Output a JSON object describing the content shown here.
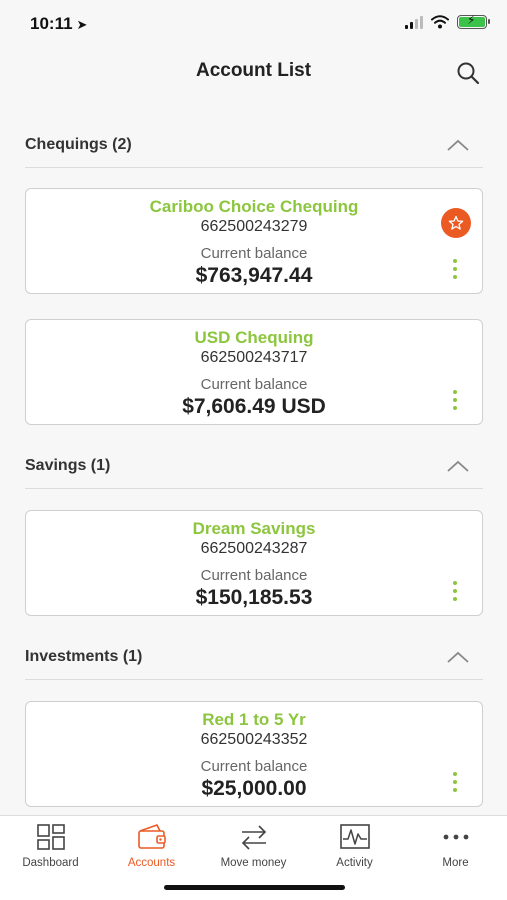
{
  "status": {
    "time": "10:11"
  },
  "header": {
    "title": "Account List"
  },
  "sections": [
    {
      "title": "Chequings (2)",
      "accounts": [
        {
          "name": "Cariboo Choice Chequing",
          "number": "662500243279",
          "balance_label": "Current balance",
          "balance": "$763,947.44",
          "favorite": true
        },
        {
          "name": "USD Chequing",
          "number": "662500243717",
          "balance_label": "Current balance",
          "balance": "$7,606.49 USD",
          "favorite": false
        }
      ]
    },
    {
      "title": "Savings (1)",
      "accounts": [
        {
          "name": "Dream Savings",
          "number": "662500243287",
          "balance_label": "Current balance",
          "balance": "$150,185.53",
          "favorite": false
        }
      ]
    },
    {
      "title": "Investments (1)",
      "accounts": [
        {
          "name": "Red 1 to 5 Yr",
          "number": "662500243352",
          "balance_label": "Current balance",
          "balance": "$25,000.00",
          "favorite": false
        }
      ]
    }
  ],
  "tabs": [
    {
      "label": "Dashboard",
      "icon": "dashboard-icon",
      "active": false
    },
    {
      "label": "Accounts",
      "icon": "wallet-icon",
      "active": true
    },
    {
      "label": "Move money",
      "icon": "transfer-arrows-icon",
      "active": false
    },
    {
      "label": "Activity",
      "icon": "activity-chart-icon",
      "active": false
    },
    {
      "label": "More",
      "icon": "more-dots-icon",
      "active": false
    }
  ],
  "colors": {
    "accent": "#ec5a24",
    "account_name": "#8cc63f",
    "background": "#f7f7f7"
  }
}
